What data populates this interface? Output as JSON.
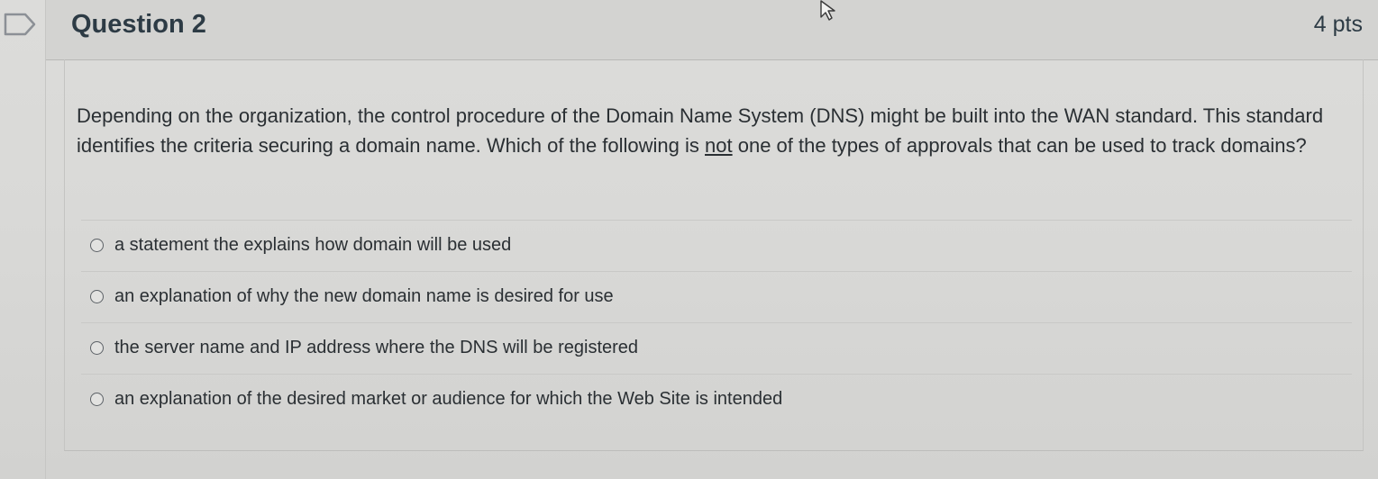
{
  "question": {
    "title": "Question 2",
    "points": "4 pts",
    "text_before": "Depending on the organization, the control procedure of the Domain Name System (DNS) might be built into the WAN standard. This standard identifies the criteria securing a domain name. Which of the following is ",
    "text_emphasis": "not",
    "text_after": " one of the types of approvals that can be used to track domains?"
  },
  "answers": [
    {
      "label": "a statement the explains how domain will be used"
    },
    {
      "label": "an explanation of why the new domain name is desired for use"
    },
    {
      "label": "the server name and IP address where the DNS will be registered"
    },
    {
      "label": "an explanation of the desired market or audience for which the Web Site is intended"
    }
  ],
  "icons": {
    "flag": "bookmark-flag-icon",
    "cursor": "mouse-pointer-icon"
  },
  "colors": {
    "text": "#2d3b45",
    "background": "#d9d9d7"
  }
}
